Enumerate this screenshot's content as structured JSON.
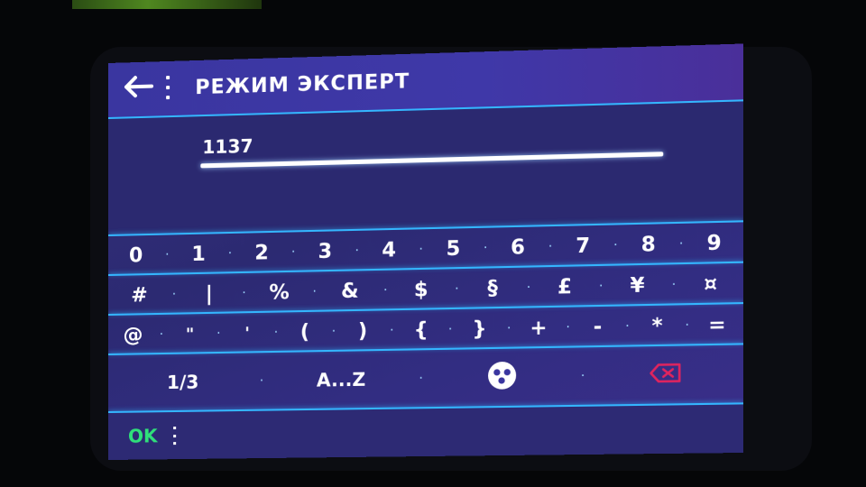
{
  "header": {
    "back_icon": "arrow-left-icon",
    "menu_icon": "vertical-dots-icon",
    "title": "РЕЖИМ ЭКСПЕРТ"
  },
  "input": {
    "value": "1137"
  },
  "keyboard": {
    "row1": [
      "0",
      "1",
      "2",
      "3",
      "4",
      "5",
      "6",
      "7",
      "8",
      "9"
    ],
    "row2": [
      "#",
      "|",
      "%",
      "&",
      "$",
      "§",
      "£",
      "¥",
      "¤"
    ],
    "row3": [
      "@",
      "\"",
      "'",
      "(",
      ")",
      "{",
      "}",
      "+",
      "-",
      "*",
      "="
    ],
    "row4": {
      "page_label": "1/3",
      "alpha_label": "A...Z",
      "emoji_icon": "emoji-icon",
      "delete_icon": "backspace-icon"
    }
  },
  "footer": {
    "ok_label": "OK",
    "menu_icon": "vertical-dots-icon"
  },
  "colors": {
    "accent": "#34b6ff",
    "background": "#2d2a74",
    "ok": "#2fe07a",
    "delete": "#e0245e"
  }
}
